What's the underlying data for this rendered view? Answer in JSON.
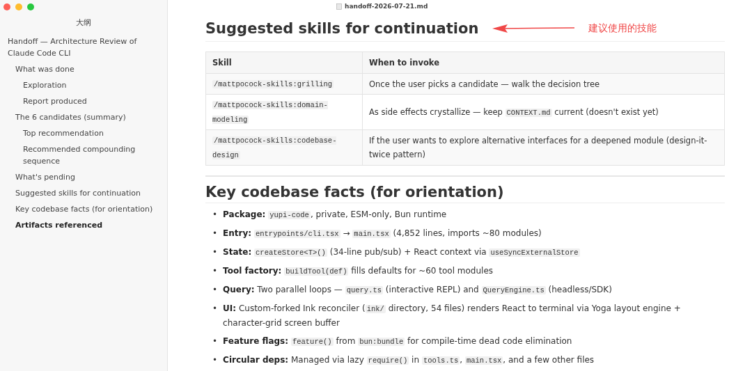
{
  "window": {
    "title": "handoff-2026-07-21.md"
  },
  "sidebar": {
    "title": "大纲",
    "items": [
      {
        "label": "Handoff — Architecture Review of Claude Code CLI",
        "selected": false,
        "children": [
          {
            "label": "What was done",
            "selected": false,
            "children": [
              {
                "label": "Exploration",
                "selected": false
              },
              {
                "label": "Report produced",
                "selected": false
              }
            ]
          },
          {
            "label": "The 6 candidates (summary)",
            "selected": false,
            "children": [
              {
                "label": "Top recommendation",
                "selected": false
              },
              {
                "label": "Recommended compounding sequence",
                "selected": false
              }
            ]
          },
          {
            "label": "What's pending",
            "selected": false
          },
          {
            "label": "Suggested skills for continuation",
            "selected": false
          },
          {
            "label": "Key codebase facts (for orientation)",
            "selected": false
          },
          {
            "label": "Artifacts referenced",
            "selected": true
          }
        ]
      }
    ]
  },
  "document": {
    "heading_1": "Suggested skills for continuation",
    "annotation": "建议使用的技能",
    "table": {
      "columns": [
        "Skill",
        "When to invoke"
      ],
      "rows": [
        [
          [
            {
              "kind": "code",
              "text": "/mattpocock-skills:grilling"
            }
          ],
          [
            {
              "kind": "text",
              "text": "Once the user picks a candidate — walk the decision tree"
            }
          ]
        ],
        [
          [
            {
              "kind": "code",
              "text": "/mattpocock-skills:domain-modeling"
            }
          ],
          [
            {
              "kind": "text",
              "text": "As side effects crystallize — keep "
            },
            {
              "kind": "code",
              "text": "CONTEXT.md"
            },
            {
              "kind": "text",
              "text": " current (doesn't exist yet)"
            }
          ]
        ],
        [
          [
            {
              "kind": "code",
              "text": "/mattpocock-skills:codebase-design"
            }
          ],
          [
            {
              "kind": "text",
              "text": "If the user wants to explore alternative interfaces for a deepened module (design-it-twice pattern)"
            }
          ]
        ]
      ]
    },
    "heading_2": "Key codebase facts (for orientation)",
    "bullets": [
      {
        "marker": "•",
        "label": "Package:",
        "parts": [
          {
            "kind": "code",
            "text": "yupi-code"
          },
          {
            "kind": "text",
            "text": ", private, ESM-only, Bun runtime"
          }
        ]
      },
      {
        "marker": "•",
        "label": "Entry:",
        "parts": [
          {
            "kind": "code",
            "text": "entrypoints/cli.tsx"
          },
          {
            "kind": "text",
            "text": " → "
          },
          {
            "kind": "code",
            "text": "main.tsx"
          },
          {
            "kind": "text",
            "text": " (4,852 lines, imports ~80 modules)"
          }
        ]
      },
      {
        "marker": "•",
        "label": "State:",
        "parts": [
          {
            "kind": "code",
            "text": "createStore<T>()"
          },
          {
            "kind": "text",
            "text": " (34-line pub/sub) + React context via "
          },
          {
            "kind": "code",
            "text": "useSyncExternalStore"
          }
        ]
      },
      {
        "marker": "•",
        "label": "Tool factory:",
        "parts": [
          {
            "kind": "code",
            "text": "buildTool(def)"
          },
          {
            "kind": "text",
            "text": " fills defaults for ~60 tool modules"
          }
        ]
      },
      {
        "marker": "•",
        "label": "Query:",
        "parts": [
          {
            "kind": "text",
            "text": "Two parallel loops — "
          },
          {
            "kind": "code",
            "text": "query.ts"
          },
          {
            "kind": "text",
            "text": " (interactive REPL) and "
          },
          {
            "kind": "code",
            "text": "QueryEngine.ts"
          },
          {
            "kind": "text",
            "text": " (headless/SDK)"
          }
        ]
      },
      {
        "marker": "•",
        "label": "UI:",
        "parts": [
          {
            "kind": "text",
            "text": "Custom-forked Ink reconciler ("
          },
          {
            "kind": "code",
            "text": "ink/"
          },
          {
            "kind": "text",
            "text": " directory, 54 files) renders React to terminal via Yoga layout engine + character-grid screen buffer"
          }
        ]
      },
      {
        "marker": "•",
        "label": "Feature flags:",
        "parts": [
          {
            "kind": "code",
            "text": "feature()"
          },
          {
            "kind": "text",
            "text": " from "
          },
          {
            "kind": "code",
            "text": "bun:bundle"
          },
          {
            "kind": "text",
            "text": " for compile-time dead code elimination"
          }
        ]
      },
      {
        "marker": "•",
        "label": "Circular deps:",
        "parts": [
          {
            "kind": "text",
            "text": "Managed via lazy "
          },
          {
            "kind": "code",
            "text": "require()"
          },
          {
            "kind": "text",
            "text": " in "
          },
          {
            "kind": "code",
            "text": "tools.ts"
          },
          {
            "kind": "text",
            "text": ", "
          },
          {
            "kind": "code",
            "text": "main.tsx"
          },
          {
            "kind": "text",
            "text": ", and a few other files"
          }
        ]
      }
    ]
  }
}
